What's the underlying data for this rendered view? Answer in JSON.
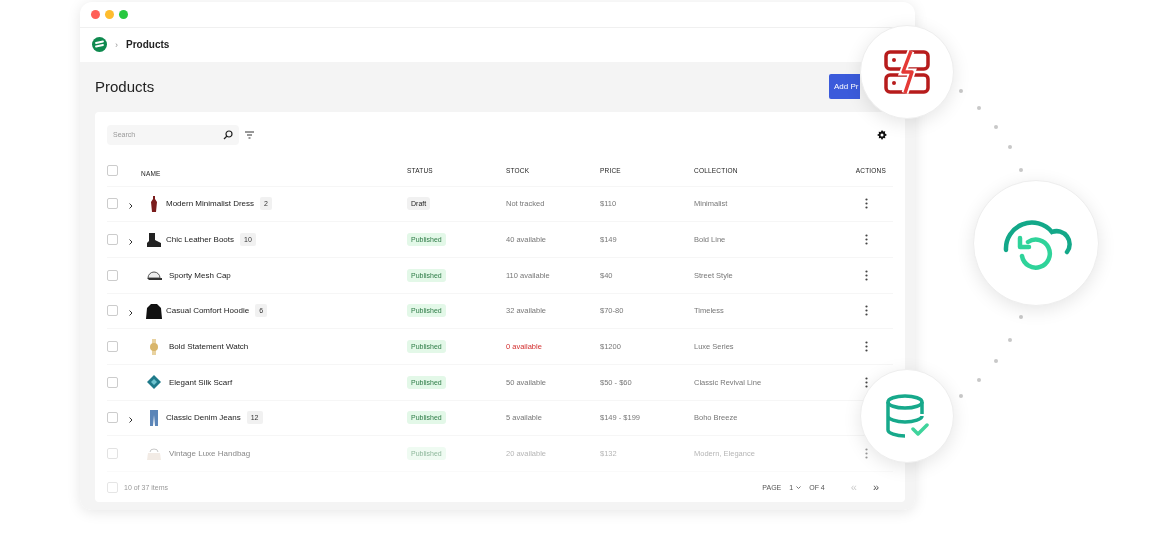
{
  "breadcrumb": {
    "separator": "›",
    "current": "Products"
  },
  "page": {
    "title": "Products",
    "add_button": "Add Pr"
  },
  "search": {
    "placeholder": "Search"
  },
  "table": {
    "select_all_checked": false,
    "columns": [
      "NAME",
      "STATUS",
      "STOCK",
      "PRICE",
      "COLLECTION",
      "ACTIONS"
    ],
    "rows": [
      {
        "name": "Modern Minimalist Dress",
        "variants": "2",
        "status": "Draft",
        "kind": "draft",
        "stock": "Not tracked",
        "stock_alert": false,
        "price": "$110",
        "collection": "Minimalist",
        "faded": false,
        "checked": false
      },
      {
        "name": "Chic Leather Boots",
        "variants": "10",
        "status": "Published",
        "kind": "published",
        "stock": "40 available",
        "stock_alert": false,
        "price": "$149",
        "collection": "Bold Line",
        "faded": false,
        "checked": false
      },
      {
        "name": "Sporty Mesh Cap",
        "status": "Published",
        "kind": "published",
        "stock": "110 available",
        "stock_alert": false,
        "price": "$40",
        "collection": "Street Style",
        "faded": false,
        "checked": false
      },
      {
        "name": "Casual Comfort Hoodie",
        "variants": "6",
        "status": "Published",
        "kind": "published",
        "stock": "32 available",
        "stock_alert": false,
        "price": "$70-80",
        "collection": "Timeless",
        "faded": false,
        "checked": false
      },
      {
        "name": "Bold Statement Watch",
        "status": "Published",
        "kind": "published",
        "stock": "0 available",
        "stock_alert": true,
        "price": "$1200",
        "collection": "Luxe Series",
        "faded": false,
        "checked": false
      },
      {
        "name": "Elegant Silk Scarf",
        "status": "Published",
        "kind": "published",
        "stock": "50 available",
        "stock_alert": false,
        "price": "$50 - $60",
        "collection": "Classic Revival Line",
        "faded": false,
        "checked": false
      },
      {
        "name": "Classic Denim Jeans",
        "variants": "12",
        "status": "Published",
        "kind": "published",
        "stock": "5 available",
        "stock_alert": false,
        "price": "$149 - $199",
        "collection": "Boho Breeze",
        "faded": false,
        "checked": false
      },
      {
        "name": "Vintage Luxe Handbag",
        "status": "Published",
        "kind": "published",
        "stock": "20 available",
        "stock_alert": false,
        "price": "$132",
        "collection": "Modern, Elegance",
        "faded": true,
        "checked": false
      }
    ]
  },
  "footer": {
    "checked": false,
    "count": "10 of 37 items",
    "page_label": "PAGE",
    "page": "1",
    "of": "OF 4",
    "prev": "«",
    "prev_disabled": true,
    "next": "»",
    "next_disabled": false
  }
}
